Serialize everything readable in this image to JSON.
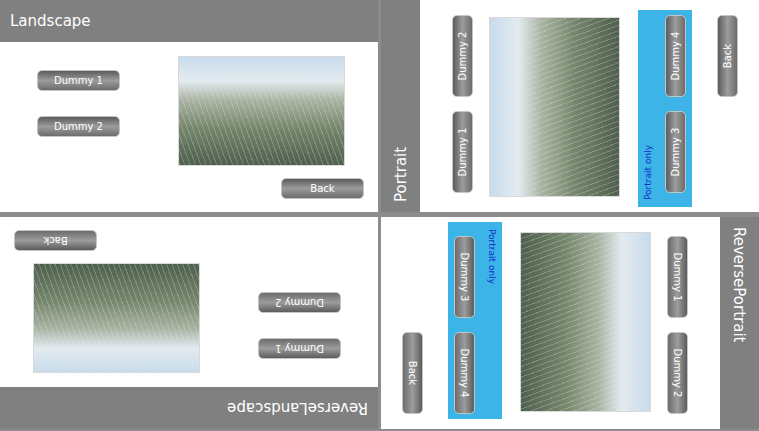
{
  "screens": [
    {
      "title": "Landscape",
      "kind": "landscape",
      "reversed": false,
      "buttons": [
        "Dummy 1",
        "Dummy 2"
      ],
      "back": "Back"
    },
    {
      "title": "Portrait",
      "kind": "portrait",
      "reversed": false,
      "buttons": [
        "Dummy 1",
        "Dummy 2"
      ],
      "extra": {
        "label": "Portrait only",
        "buttons": [
          "Dummy 3",
          "Dummy 4"
        ]
      },
      "back": "Back"
    },
    {
      "title": "ReverseLandscape",
      "kind": "landscape",
      "reversed": true,
      "buttons": [
        "Dummy 1",
        "Dummy 2"
      ],
      "back": "Back"
    },
    {
      "title": "ReversePortrait",
      "kind": "portrait",
      "reversed": true,
      "buttons": [
        "Dummy 1",
        "Dummy 2"
      ],
      "extra": {
        "label": "Portrait only",
        "buttons": [
          "Dummy 3",
          "Dummy 4"
        ]
      },
      "back": "Back"
    }
  ]
}
